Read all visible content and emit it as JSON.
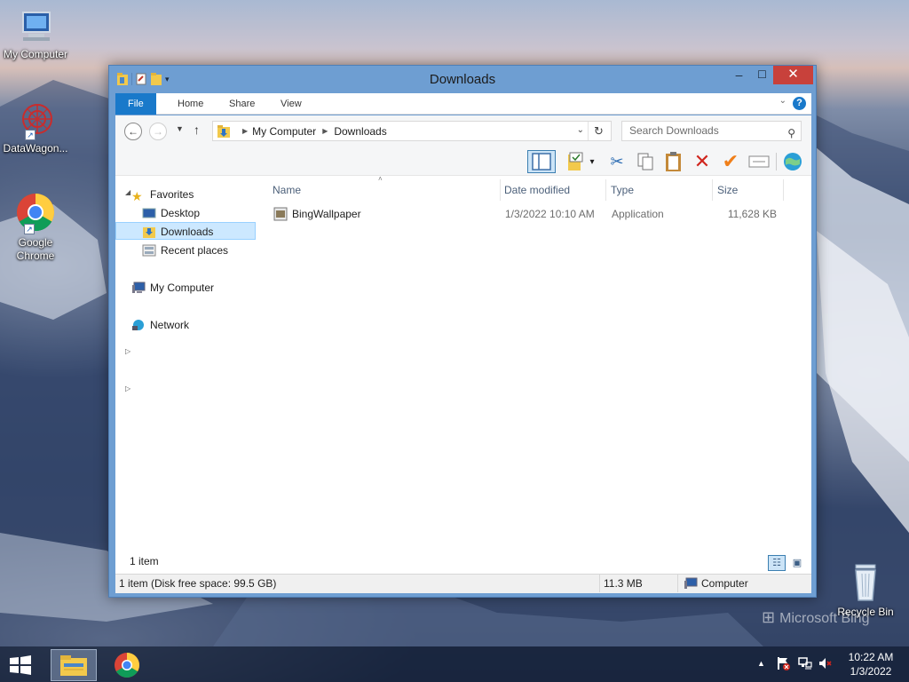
{
  "desktop": {
    "icons": [
      {
        "label": "My Computer"
      },
      {
        "label": "DataWagon..."
      },
      {
        "label": "Google Chrome"
      },
      {
        "label": "Recycle Bin"
      }
    ],
    "watermark": "Microsoft Bing"
  },
  "window": {
    "title": "Downloads",
    "controls": {
      "minimize": "–",
      "maximize": "☐",
      "close": "✕"
    },
    "ribbon": {
      "tabs": [
        "File",
        "Home",
        "Share",
        "View"
      ],
      "active_tab": "File"
    },
    "address": {
      "segments": [
        "My Computer",
        "Downloads"
      ],
      "search_placeholder": "Search Downloads"
    },
    "nav_pane": {
      "favorites": "Favorites",
      "favorites_items": [
        "Desktop",
        "Downloads",
        "Recent places"
      ],
      "selected": "Downloads",
      "my_computer": "My Computer",
      "network": "Network"
    },
    "columns": [
      "Name",
      "Date modified",
      "Type",
      "Size"
    ],
    "files": [
      {
        "name": "BingWallpaper",
        "date_modified": "1/3/2022 10:10 AM",
        "type": "Application",
        "size": "11,628 KB"
      }
    ],
    "item_count": "1 item",
    "status": {
      "left": "1 item (Disk free space: 99.5 GB)",
      "size": "11.3 MB",
      "location": "Computer"
    }
  },
  "taskbar": {
    "clock_time": "10:22 AM",
    "clock_date": "1/3/2022"
  },
  "colors": {
    "accent": "#1979ca",
    "window_frame": "#6e9ed2",
    "close_button": "#c8413b",
    "selection": "#cce8ff"
  }
}
